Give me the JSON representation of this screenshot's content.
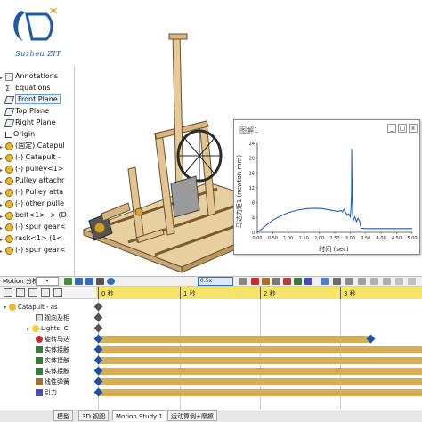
{
  "logo": {
    "name": "Suzhou ZIT"
  },
  "feature_tree": {
    "items": [
      {
        "label": "Annotations",
        "icon": "annotations-icon"
      },
      {
        "label": "Equations",
        "icon": "equations-icon"
      },
      {
        "label": "Front Plane",
        "icon": "plane-icon",
        "selected": true
      },
      {
        "label": "Top Plane",
        "icon": "plane-icon"
      },
      {
        "label": "Right Plane",
        "icon": "plane-icon"
      },
      {
        "label": "Origin",
        "icon": "origin-icon"
      },
      {
        "label": "(固定) Catapul",
        "icon": "part-icon"
      },
      {
        "label": "(-) Catapult -",
        "icon": "part-icon"
      },
      {
        "label": "(-) pulley<1>",
        "icon": "part-icon"
      },
      {
        "label": "Pulley attachr",
        "icon": "part-icon"
      },
      {
        "label": "(-) Pulley atta",
        "icon": "part-icon"
      },
      {
        "label": "(-) other pulle",
        "icon": "part-icon"
      },
      {
        "label": "belt<1> -> (D",
        "icon": "part-icon"
      },
      {
        "label": "(-) spur gear<",
        "icon": "part-icon"
      },
      {
        "label": "rack<1> (1<",
        "icon": "part-icon"
      },
      {
        "label": "(-) spur gear<",
        "icon": "part-icon"
      }
    ]
  },
  "graph": {
    "title": "图解1",
    "buttons": [
      "_",
      "□",
      "x"
    ]
  },
  "chart_data": {
    "type": "line",
    "title": "",
    "xlabel": "时间 (sec)",
    "ylabel": "马达力矩1 (newton-mm)",
    "xlim": [
      0,
      5
    ],
    "ylim": [
      0,
      24
    ],
    "xticks": [
      "0.00",
      "0.50",
      "1.00",
      "1.50",
      "2.00",
      "2.50",
      "3.00",
      "3.50",
      "4.00",
      "4.50",
      "5.00"
    ],
    "yticks": [
      "0",
      "4",
      "8",
      "12",
      "16",
      "20",
      "24"
    ],
    "series": [
      {
        "color": "#1f5fbf",
        "x": [
          0,
          0.1,
          0.3,
          0.5,
          0.8,
          1.0,
          1.3,
          1.6,
          1.9,
          2.1,
          2.3,
          2.5,
          2.6,
          2.7,
          2.75,
          2.8,
          2.85,
          2.9,
          2.95,
          3.0,
          3.02,
          3.04,
          3.05,
          3.06,
          3.08,
          3.1,
          3.15,
          3.2,
          3.25,
          3.3,
          3.35,
          3.5,
          4.0,
          4.5,
          5.0
        ],
        "y": [
          0,
          0.6,
          2.0,
          3.3,
          4.6,
          5.3,
          6.0,
          6.4,
          6.5,
          6.4,
          6.1,
          5.8,
          5.6,
          5.9,
          5.5,
          6.2,
          5.4,
          4.6,
          5.0,
          4.2,
          6.0,
          10,
          22.5,
          10,
          4.5,
          3.3,
          4.2,
          2.9,
          3.8,
          3.1,
          1.1,
          1.0,
          1.0,
          1.0,
          1.0
        ]
      }
    ],
    "grid": false
  },
  "motion": {
    "study_type_label": "Motion 分析",
    "zoom_value": "0.5x",
    "time_labels": [
      "0 秒",
      "1 秒",
      "2 秒",
      "3 秒"
    ],
    "rows": [
      {
        "label": "Catapult - as"
      },
      {
        "label": "视向及相"
      },
      {
        "label": "Lights, C"
      },
      {
        "label": "旋转马达"
      },
      {
        "label": "实体接触"
      },
      {
        "label": "实体接触"
      },
      {
        "label": "实体接触"
      },
      {
        "label": "线性弹簧"
      },
      {
        "label": "引力"
      }
    ]
  },
  "tabs": [
    "模型",
    "3D 视图",
    "Motion Study 1",
    "运动算例+摩擦"
  ],
  "colors": {
    "bar": "#d8ad58",
    "ruler": "#f4e56a",
    "key_blue": "#1f4fa8",
    "key_gray": "#555555",
    "curve": "#1f5fbf"
  }
}
